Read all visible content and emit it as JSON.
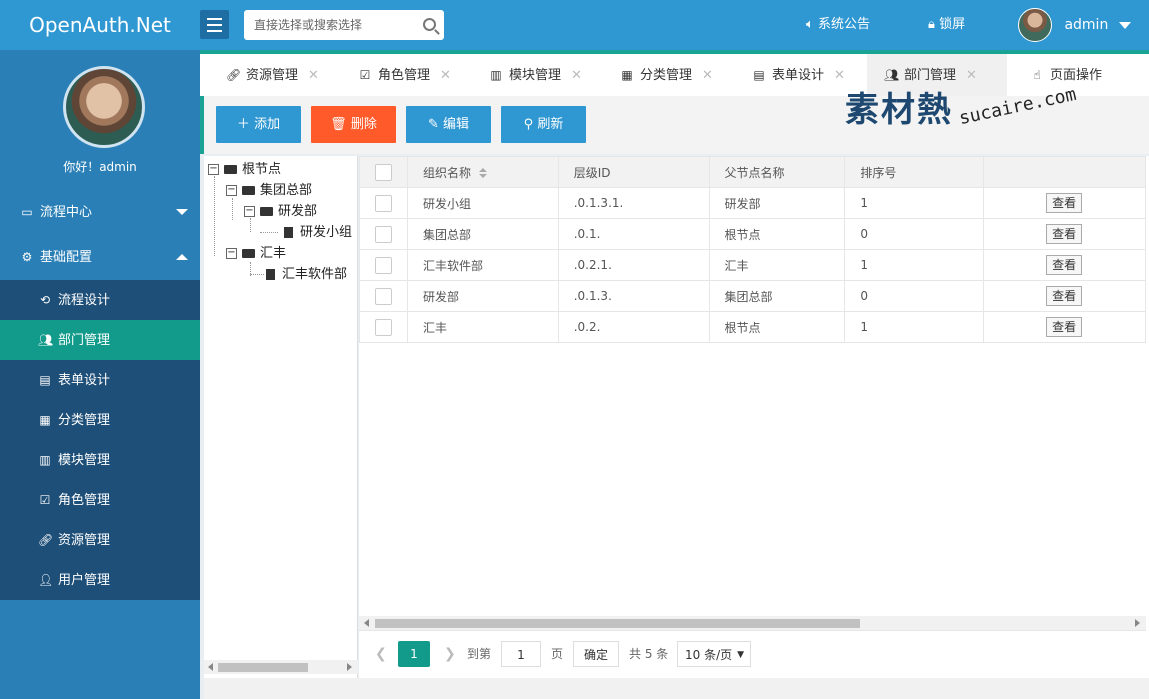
{
  "app": {
    "title": "OpenAuth.Net"
  },
  "header": {
    "search_placeholder": "直接选择或搜索选择",
    "notice": "系统公告",
    "lock": "锁屏",
    "username": "admin"
  },
  "sidebar": {
    "greeting": "你好！admin",
    "groups": [
      {
        "label": "流程中心",
        "expanded": false
      },
      {
        "label": "基础配置",
        "expanded": true
      }
    ],
    "items": [
      {
        "label": "流程设计",
        "icon": "flow-icon"
      },
      {
        "label": "部门管理",
        "icon": "users-icon",
        "active": true
      },
      {
        "label": "表单设计",
        "icon": "form-icon"
      },
      {
        "label": "分类管理",
        "icon": "category-icon"
      },
      {
        "label": "模块管理",
        "icon": "module-icon"
      },
      {
        "label": "角色管理",
        "icon": "check-square-icon"
      },
      {
        "label": "资源管理",
        "icon": "link-icon"
      },
      {
        "label": "用户管理",
        "icon": "user-icon"
      }
    ]
  },
  "tabs": [
    {
      "label": "资源管理",
      "icon": "link-icon"
    },
    {
      "label": "角色管理",
      "icon": "check-square-icon"
    },
    {
      "label": "模块管理",
      "icon": "module-icon"
    },
    {
      "label": "分类管理",
      "icon": "category-icon"
    },
    {
      "label": "表单设计",
      "icon": "form-icon"
    },
    {
      "label": "部门管理",
      "icon": "users-icon",
      "active": true
    },
    {
      "label": "页面操作",
      "icon": "hand-icon"
    }
  ],
  "watermark": {
    "main": "素材熱",
    "sub": "sucaire.com"
  },
  "toolbar": {
    "add": "添加",
    "delete": "删除",
    "edit": "编辑",
    "refresh": "刷新"
  },
  "tree": {
    "root": "根节点",
    "n1": "集团总部",
    "n11": "研发部",
    "n111": "研发小组",
    "n2": "汇丰",
    "n21": "汇丰软件部"
  },
  "grid": {
    "columns": [
      "组织名称",
      "层级ID",
      "父节点名称",
      "排序号"
    ],
    "view_label": "查看",
    "rows": [
      {
        "name": "研发小组",
        "cascade": ".0.1.3.1.",
        "parent": "研发部",
        "sort": "1"
      },
      {
        "name": "集团总部",
        "cascade": ".0.1.",
        "parent": "根节点",
        "sort": "0"
      },
      {
        "name": "汇丰软件部",
        "cascade": ".0.2.1.",
        "parent": "汇丰",
        "sort": "1"
      },
      {
        "name": "研发部",
        "cascade": ".0.1.3.",
        "parent": "集团总部",
        "sort": "0"
      },
      {
        "name": "汇丰",
        "cascade": ".0.2.",
        "parent": "根节点",
        "sort": "1"
      }
    ]
  },
  "pager": {
    "current": "1",
    "goto": "到第",
    "input": "1",
    "page": "页",
    "confirm": "确定",
    "total": "共 5 条",
    "per_page": "10 条/页"
  },
  "colors": {
    "header": "#2f97d2",
    "sidebar": "#2a7fb6",
    "submenu": "#1e4f78",
    "active": "#129b8a",
    "danger": "#ff5a2a"
  }
}
